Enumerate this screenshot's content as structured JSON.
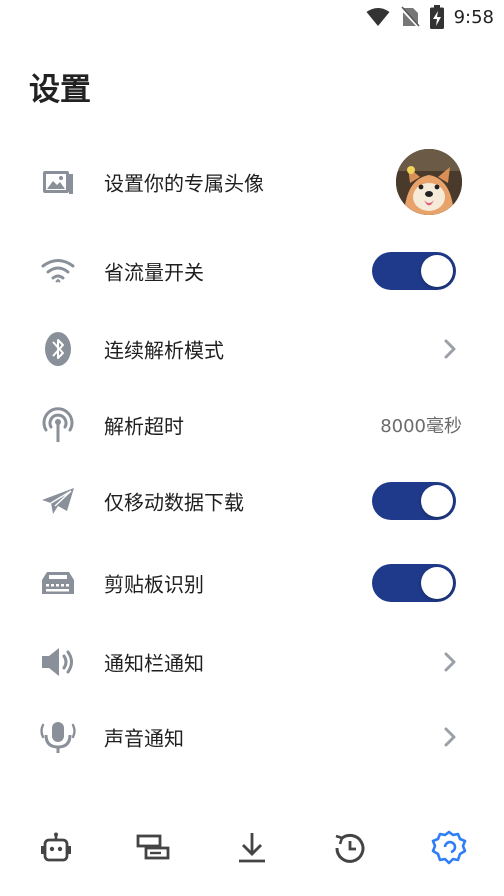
{
  "status_bar": {
    "time": "9:58",
    "icons": [
      "wifi-icon",
      "no-sim-icon",
      "battery-charging-icon"
    ]
  },
  "page": {
    "title": "设置"
  },
  "settings": [
    {
      "label": "设置你的专属头像",
      "icon": "image-icon",
      "control": "avatar"
    },
    {
      "label": "省流量开关",
      "icon": "wifi-icon",
      "control": "toggle",
      "on": true
    },
    {
      "label": "连续解析模式",
      "icon": "bluetooth-icon",
      "control": "chevron"
    },
    {
      "label": "解析超时",
      "icon": "antenna-icon",
      "control": "value",
      "value": "8000毫秒"
    },
    {
      "label": "仅移动数据下载",
      "icon": "paper-plane-icon",
      "control": "toggle",
      "on": true
    },
    {
      "label": "剪贴板识别",
      "icon": "keyboard-icon",
      "control": "toggle",
      "on": true
    },
    {
      "label": "通知栏通知",
      "icon": "speaker-icon",
      "control": "chevron"
    },
    {
      "label": "声音通知",
      "icon": "microphone-icon",
      "control": "chevron"
    }
  ],
  "bottom_nav": [
    {
      "icon": "robot-icon",
      "active": false
    },
    {
      "icon": "layers-icon",
      "active": false
    },
    {
      "icon": "download-icon",
      "active": false
    },
    {
      "icon": "history-icon",
      "active": false
    },
    {
      "icon": "settings-gear-icon",
      "active": true
    }
  ],
  "colors": {
    "accent": "#1f3a8a",
    "active_nav": "#2d7ef7",
    "icon_gray": "#8a9099",
    "text": "#1f1f1f",
    "secondary_text": "#6b6b6b"
  }
}
